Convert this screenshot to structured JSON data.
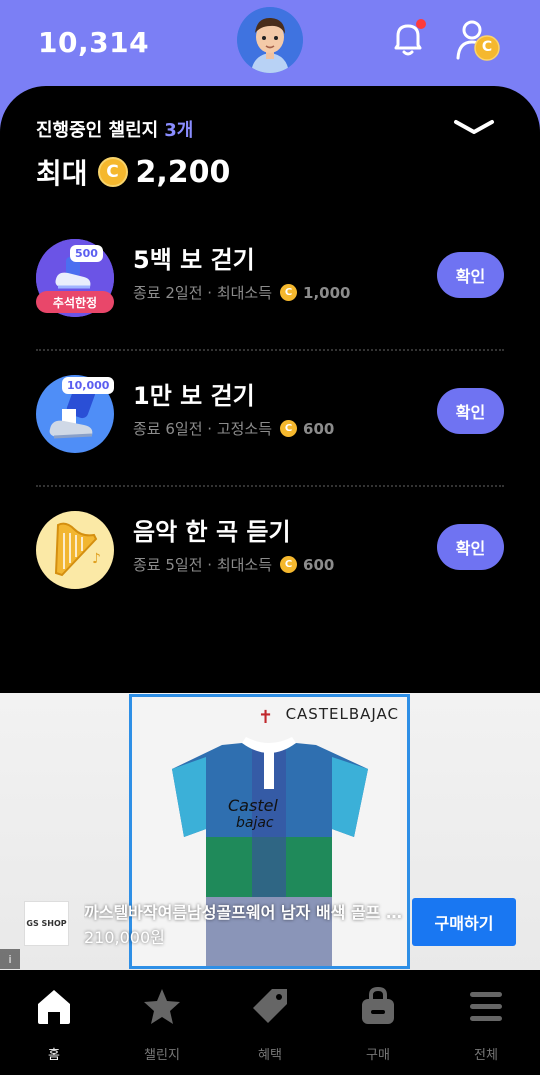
{
  "header": {
    "points": "10,314",
    "avatar_icon": "avatar-character-icon",
    "notification_icon": "bell-icon",
    "profile_icon": "profile-coin-icon",
    "coin_letter": "C"
  },
  "challenges": {
    "ongoing_label": "진행중인 챌린지",
    "ongoing_count": "3개",
    "max_label": "최대",
    "max_value": "2,200",
    "coin_letter": "C",
    "items": [
      {
        "title": "5백 보 걷기",
        "meta": "종료 2일전 · 최대소득",
        "amount": "1,000",
        "button": "확인",
        "badge": "500",
        "season_tag": "추석한정",
        "icon": "walking-shoe-icon"
      },
      {
        "title": "1만 보 걷기",
        "meta": "종료 6일전 · 고정소득",
        "amount": "600",
        "button": "확인",
        "badge": "10,000",
        "icon": "running-leg-icon"
      },
      {
        "title": "음악 한 곡 듣기",
        "meta": "종료 5일전 · 최대소득",
        "amount": "600",
        "button": "확인",
        "icon": "harp-icon"
      }
    ]
  },
  "ad": {
    "brand": "CASTELBAJAC",
    "shirt_text": "Castel bajac",
    "advertiser_logo_text": "GS SHOP",
    "title": "까스텔바작여름남성골프웨어 남자 배색 골프 티셔츠",
    "price": "210,000원",
    "buy_button": "구매하기",
    "info_label": "i"
  },
  "nav": {
    "items": [
      {
        "label": "홈",
        "icon": "home-icon",
        "active": true
      },
      {
        "label": "챌린지",
        "icon": "star-icon",
        "active": false
      },
      {
        "label": "혜택",
        "icon": "tag-icon",
        "active": false
      },
      {
        "label": "구매",
        "icon": "shopping-bag-icon",
        "active": false
      },
      {
        "label": "전체",
        "icon": "menu-icon",
        "active": false
      }
    ]
  },
  "colors": {
    "accent": "#7b7ff5",
    "button": "#6f73f2",
    "coin": "#f5b82e",
    "buy_button": "#1977f2"
  }
}
